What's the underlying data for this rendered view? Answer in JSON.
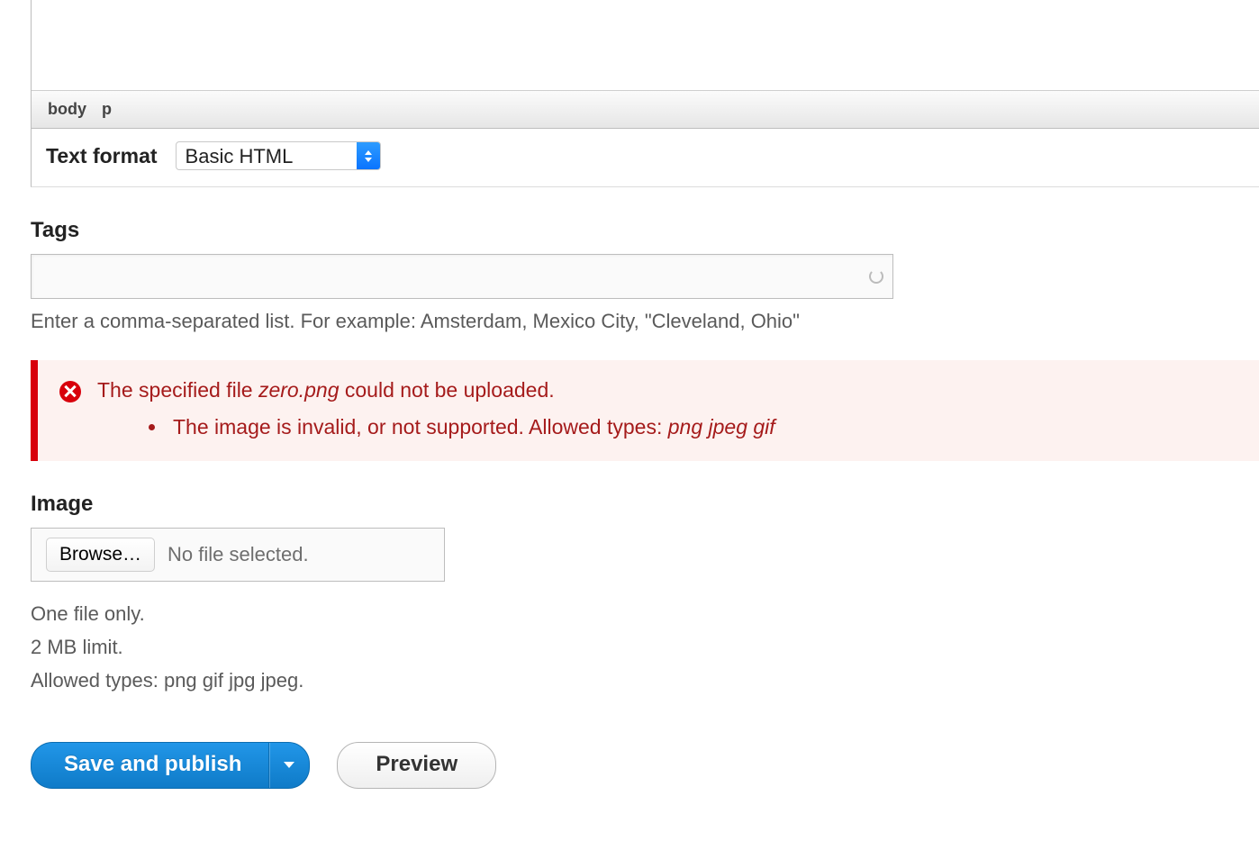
{
  "editor": {
    "path_body": "body",
    "path_p": "p"
  },
  "format": {
    "label": "Text format",
    "selected": "Basic HTML"
  },
  "tags": {
    "label": "Tags",
    "help": "Enter a comma-separated list. For example: Amsterdam, Mexico City, \"Cleveland, Ohio\""
  },
  "error": {
    "prefix": "The specified file ",
    "filename": "zero.png",
    "suffix": " could not be uploaded.",
    "detail_text": "The image is invalid, or not supported. Allowed types: ",
    "detail_types": "png jpeg gif"
  },
  "image": {
    "label": "Image",
    "browse": "Browse…",
    "no_file": "No file selected.",
    "hint1": "One file only.",
    "hint2": "2 MB limit.",
    "hint3": "Allowed types: png gif jpg jpeg."
  },
  "actions": {
    "save": "Save and publish",
    "preview": "Preview"
  }
}
